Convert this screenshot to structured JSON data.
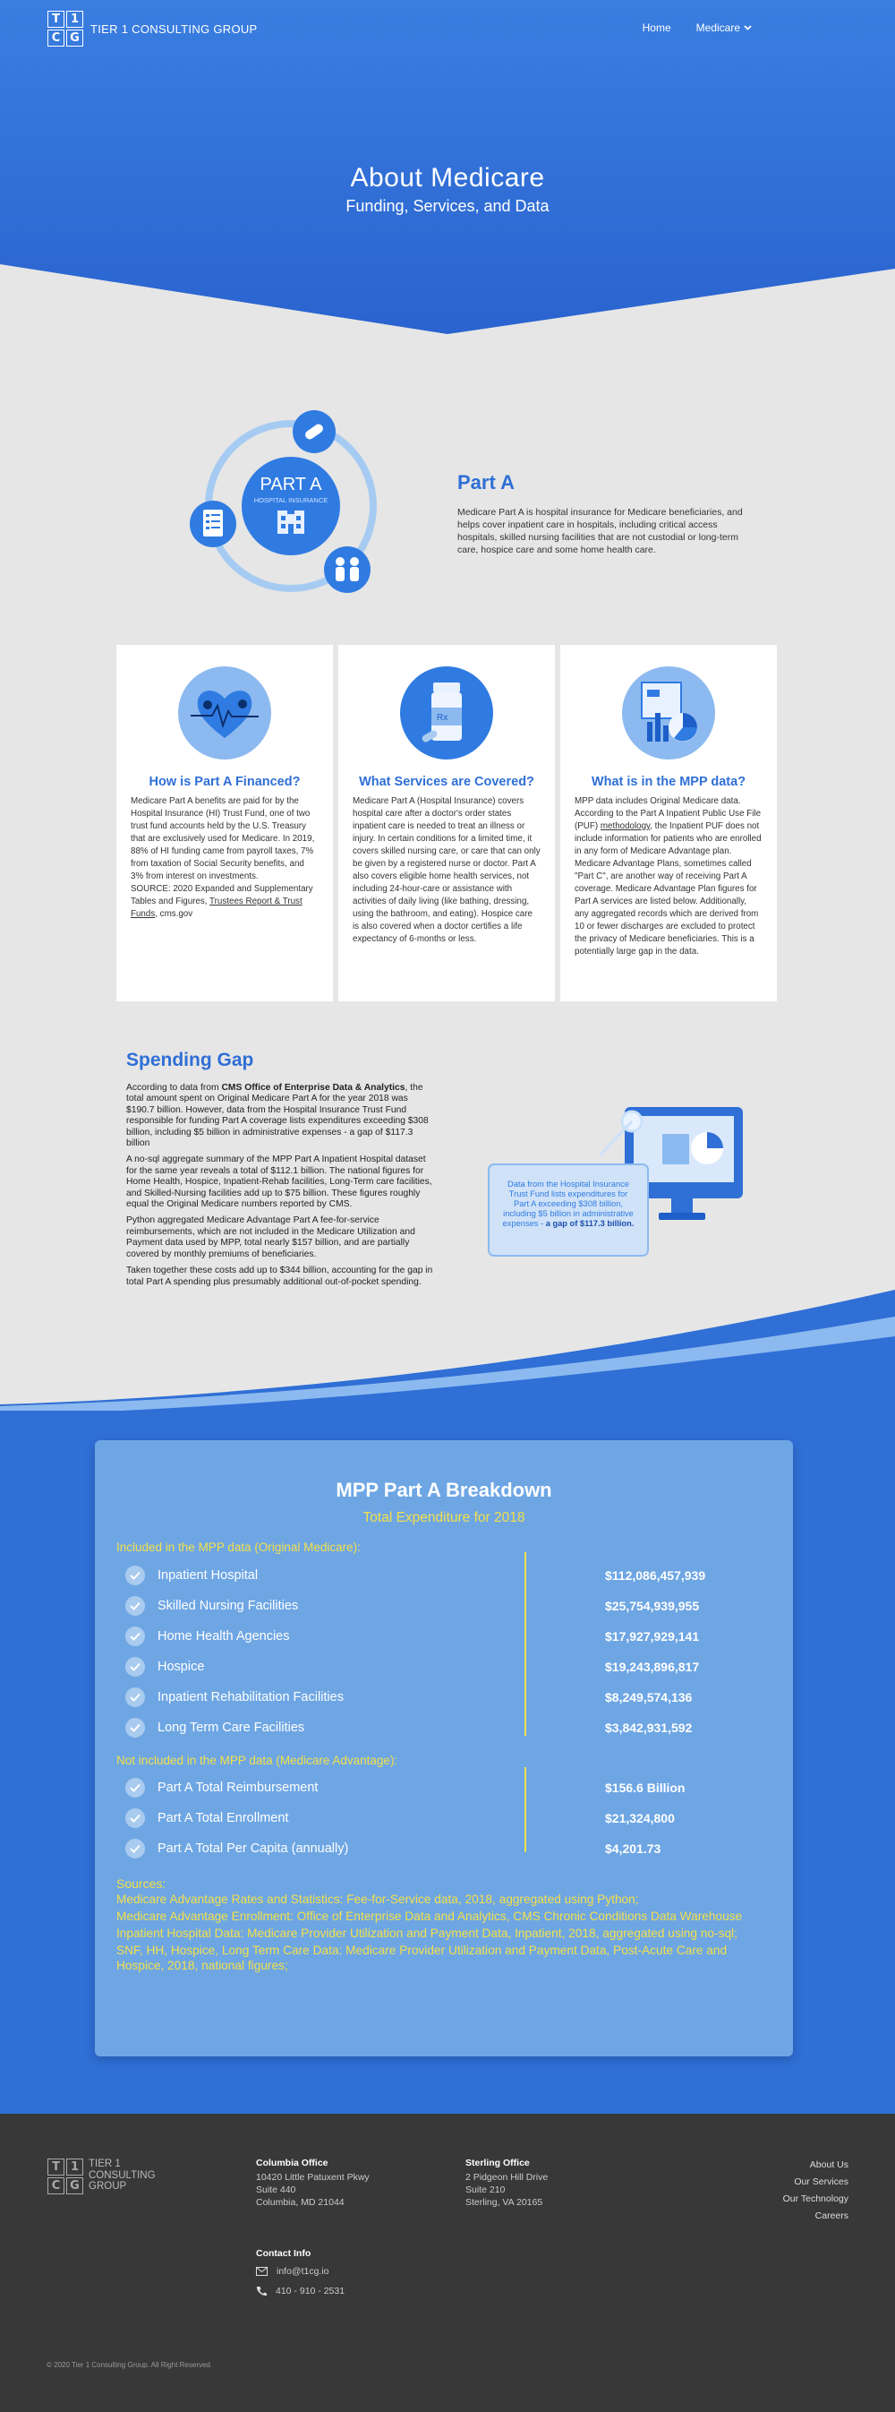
{
  "brand": {
    "logo_letters": [
      "T",
      "1",
      "C",
      "G"
    ],
    "name": "TIER 1 CONSULTING GROUP",
    "name_lines": [
      "TIER 1",
      "CONSULTING",
      "GROUP"
    ]
  },
  "nav": {
    "home": "Home",
    "medicare": "Medicare"
  },
  "hero": {
    "title": "About Medicare",
    "subtitle": "Funding, Services, and Data"
  },
  "part_a": {
    "illus_title": "PART A",
    "illus_sub": "HOSPITAL INSURANCE",
    "title": "Part A",
    "text": "Medicare Part A is hospital insurance for Medicare beneficiaries, and helps cover inpatient care in hospitals, including critical access hospitals, skilled nursing facilities that are not custodial or long-term care, hospice care and some home health care."
  },
  "cards": [
    {
      "icon": "heart-icon",
      "title": "How is Part A Financed?",
      "body": "Medicare Part A benefits are paid for by the Hospital Insurance (HI) Trust Fund, one of two trust fund accounts held by the U.S. Treasury that are exclusively used for Medicare. In 2019, 88% of HI funding came from payroll taxes, 7% from taxation of Social Security benefits, and 3% from interest on investments.",
      "source": "SOURCE: 2020 Expanded and Supplementary Tables and Figures,",
      "link": "Trustees Report & Trust Funds",
      "tail": ", cms.gov"
    },
    {
      "icon": "medicine-bottle-icon",
      "title": "What Services are Covered?",
      "body": "Medicare Part A (Hospital Insurance) covers hospital care after a doctor's order states inpatient care is needed to treat an illness or injury. In certain conditions for a limited time, it covers skilled nursing care, or care that can only be given by a registered nurse or doctor. Part A also covers eligible home health services, not including 24-hour-care or assistance with activities of daily living (like bathing, dressing, using the bathroom, and eating). Hospice care is also covered when a doctor certifies a life expectancy of 6-months or less."
    },
    {
      "icon": "data-dashboard-icon",
      "title": "What is in the MPP data?",
      "pre": "MPP data includes Original Medicare data. According to the Part A Inpatient Public Use File (PUF)",
      "link": "methodology",
      "body": ", the Inpatient PUF does not include information for patients who are enrolled in any form of Medicare Advantage plan. Medicare Advantage Plans, sometimes called \"Part C\", are another way of receiving Part A coverage. Medicare Advantage Plan figures for Part A services are listed below. Additionally, any aggregated records which are derived from 10 or fewer discharges are excluded to protect the privacy of Medicare beneficiaries. This is a potentially large gap in the data."
    }
  ],
  "spending_gap": {
    "title": "Spending Gap",
    "p1_pre": "According to data from",
    "p1_bold": "CMS Office of Enterprise Data & Analytics",
    "p1_post": ", the total amount spent on Original Medicare Part A for the year 2018 was $190.7 billion. However, data from the Hospital Insurance Trust Fund responsible for funding Part A coverage lists expenditures exceeding $308 billion, including $5 billion in administrative expenses - a gap of $117.3 billion",
    "p2": "A no-sql aggregate summary of the MPP Part A Inpatient Hospital dataset for the same year reveals a total of $112.1 billion. The national figures for Home Health, Hospice, Inpatient-Rehab facilities, Long-Term care facilities, and Skilled-Nursing facilities add up to $75 billion. These figures roughly equal the Original Medicare numbers reported by CMS.",
    "p3": "Python aggregated Medicare Advantage Part A fee-for-service reimbursements, which are not included in the Medicare Utilization and Payment data used by MPP, total nearly $157 billion, and are partially covered by monthly premiums of beneficiaries.",
    "p4": "Taken together these costs add up to $344 billion, accounting for the gap in total Part A spending plus presumably additional out-of-pocket spending.",
    "callout_lines": [
      "Data from the Hospital Insurance",
      "Trust Fund lists expenditures for",
      "Part A exceeding $308 billion,",
      "including $5 billion in administrative",
      "expenses - "
    ],
    "callout_bold": "a gap of $117.3 billion."
  },
  "breakdown": {
    "title": "MPP Part A Breakdown",
    "subtitle": "Total Expenditure for 2018",
    "included_label": "Included in the MPP data (Original Medicare):",
    "included": [
      {
        "label": "Inpatient Hospital",
        "value": "$112,086,457,939"
      },
      {
        "label": "Skilled Nursing Facilities",
        "value": "$25,754,939,955"
      },
      {
        "label": "Home Health Agencies",
        "value": "$17,927,929,141"
      },
      {
        "label": "Hospice",
        "value": "$19,243,896,817"
      },
      {
        "label": "Inpatient Rehabilitation Facilities",
        "value": "$8,249,574,136"
      },
      {
        "label": "Long Term Care Facilities",
        "value": "$3,842,931,592"
      }
    ],
    "excluded_label": "Not included in the MPP data (Medicare Advantage):",
    "excluded": [
      {
        "label": "Part A Total Reimbursement",
        "value": "$156.6 Billion"
      },
      {
        "label": "Part A Total Enrollment",
        "value": "$21,324,800"
      },
      {
        "label": "Part A Total Per Capita (annually)",
        "value": "$4,201.73"
      }
    ],
    "sources_label": "Sources:",
    "sources": [
      "Medicare Advantage Rates and Statistics: Fee-for-Service data, 2018, aggregated using Python;",
      "Medicare Advantage Enrollment: Office of Enterprise Data and Analytics, CMS Chronic Conditions Data Warehouse",
      "Inpatient Hospital Data: Medicare Provider Utilization and Payment Data, Inpatient, 2018, aggregated using no-sql;",
      "SNF, HH, Hospice, Long Term Care Data: Medicare Provider Utilization and Payment Data, Post-Acute Care and Hospice, 2018, national figures;"
    ]
  },
  "footer": {
    "columbia": {
      "heading": "Columbia Office",
      "lines": [
        "10420 Little Patuxent Pkwy",
        "Suite 440",
        "Columbia, MD 21044"
      ]
    },
    "sterling": {
      "heading": "Sterling Office",
      "lines": [
        "2 Pidgeon Hill Drive",
        "Suite 210",
        "Sterling, VA 20165"
      ]
    },
    "links": [
      "About Us",
      "Our Services",
      "Our Technology",
      "Careers"
    ],
    "contact_heading": "Contact Info",
    "email": "info@t1cg.io",
    "phone": "410 - 910 - 2531",
    "copyright": "© 2020 Tier 1 Consulting Group. All Right Reserved."
  },
  "colors": {
    "primary_blue": "#2f6fd6",
    "panel_blue": "#6ea6e4",
    "accent_yellow": "#f2e04c",
    "footer_bg": "#383838"
  }
}
